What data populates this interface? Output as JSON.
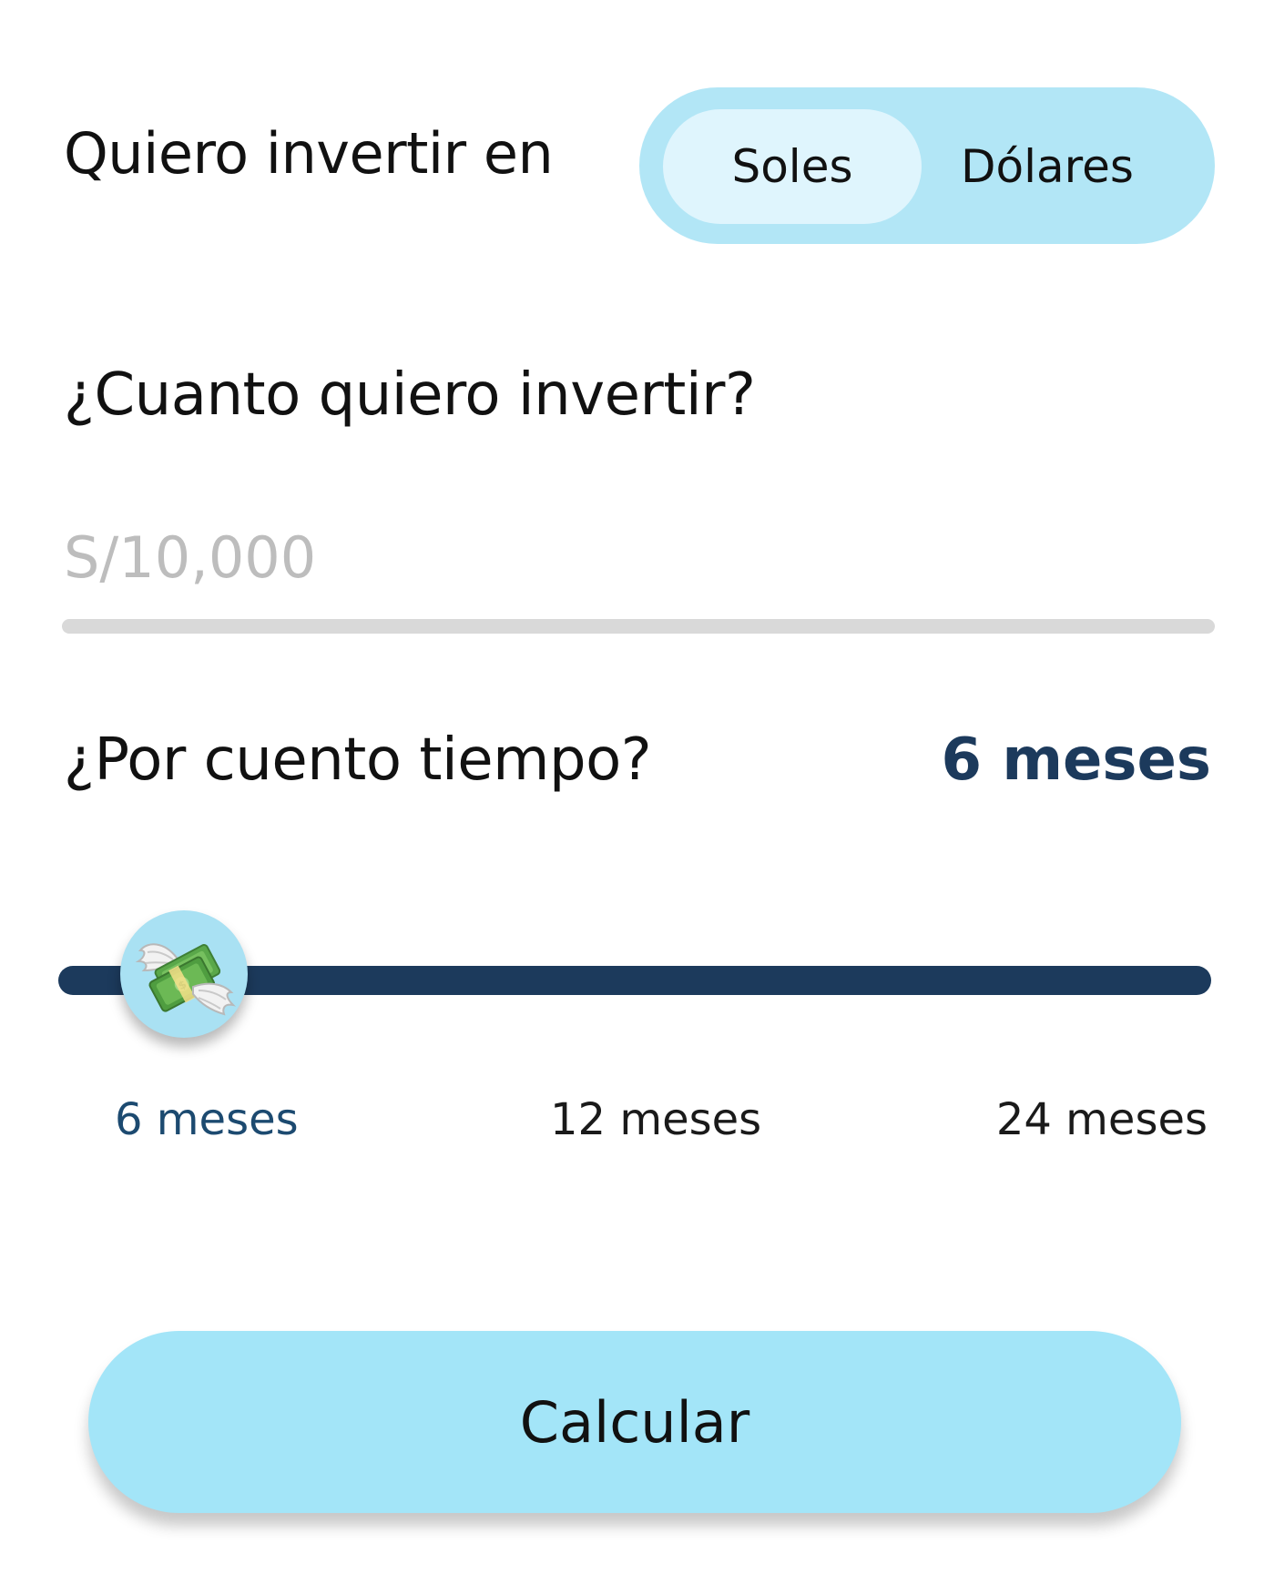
{
  "currency": {
    "label": "Quiero invertir en",
    "options": [
      {
        "label": "Soles",
        "selected": true
      },
      {
        "label": "Dólares",
        "selected": false
      }
    ]
  },
  "amount": {
    "question": "¿Cuanto quiero invertir?",
    "value": "",
    "placeholder": "S/10,000"
  },
  "term": {
    "question": "¿Por cuento tiempo?",
    "selected_label": "6 meses",
    "slider": {
      "thumb_icon": "money-with-wings-icon",
      "selected_index": 0
    },
    "ticks": [
      "6 meses",
      "12 meses",
      "24 meses"
    ]
  },
  "actions": {
    "calculate_label": "Calcular"
  },
  "colors": {
    "segment_bg": "#b2e6f6",
    "segment_selected": "#dff5fd",
    "accent_navy": "#1c3a5c",
    "button_bg": "#a3e5f8",
    "underline": "#d9d9d9",
    "placeholder": "#bdbdbd"
  }
}
